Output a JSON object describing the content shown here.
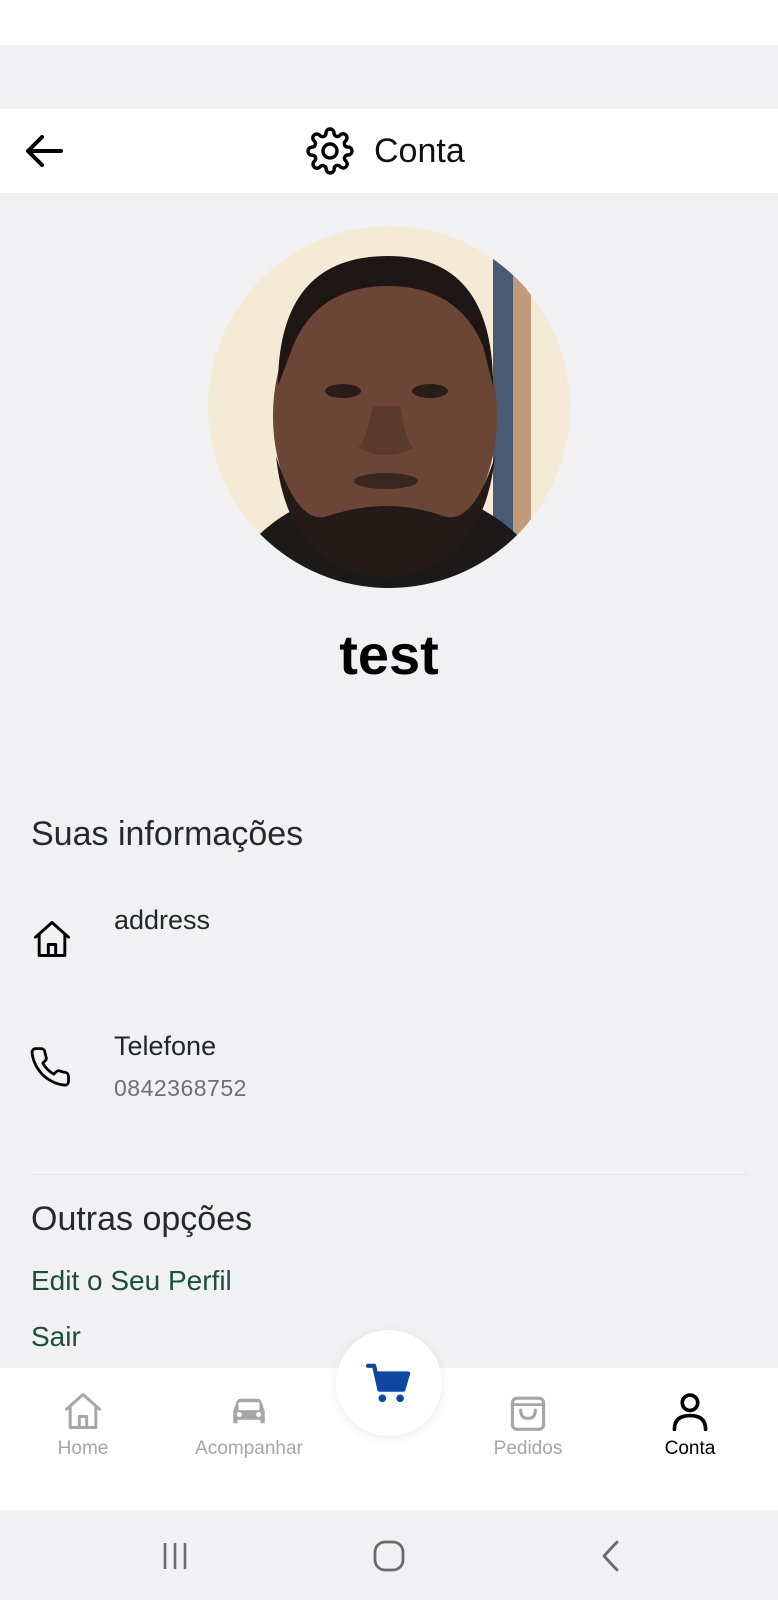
{
  "header": {
    "title": "Conta",
    "back_icon": "arrow-left-icon",
    "title_icon": "gear-icon"
  },
  "profile": {
    "name": "test",
    "avatar": "profile-photo"
  },
  "info_section": {
    "title": "Suas informações",
    "items": [
      {
        "icon": "home-icon",
        "label": "address",
        "value": ""
      },
      {
        "icon": "phone-icon",
        "label": "Telefone",
        "value": "0842368752"
      }
    ]
  },
  "options_section": {
    "title": "Outras opções",
    "items": [
      {
        "label": "Edit o Seu Perfil"
      },
      {
        "label": "Sair"
      }
    ]
  },
  "bottom_nav": {
    "items": [
      {
        "label": "Home",
        "icon": "home-icon",
        "active": false
      },
      {
        "label": "Acompanhar",
        "icon": "car-icon",
        "active": false
      },
      {
        "label": "Pedidos",
        "icon": "shopping-bag-icon",
        "active": false
      },
      {
        "label": "Conta",
        "icon": "user-icon",
        "active": true
      }
    ],
    "center_button_icon": "cart-icon"
  },
  "colors": {
    "background": "#f1f1f3",
    "link": "#1b4f3a",
    "cart_accent": "#0d47a1",
    "nav_inactive": "#a6a6a9",
    "nav_active": "#000000"
  }
}
